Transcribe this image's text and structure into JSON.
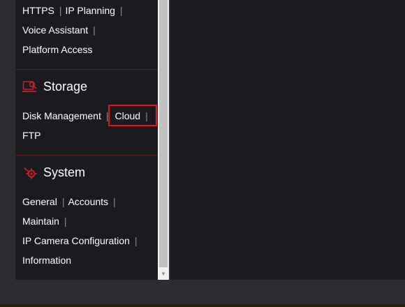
{
  "network": {
    "links": [
      "HTTPS",
      "IP Planning",
      "Voice Assistant",
      "Platform Access"
    ],
    "separator": "|"
  },
  "storage": {
    "title": "Storage",
    "icon": "storage-icon",
    "links": [
      "Disk Management",
      "Cloud",
      "FTP"
    ],
    "separator": "|"
  },
  "system": {
    "title": "System",
    "icon": "system-gear-icon",
    "links": [
      "General",
      "Accounts",
      "Maintain",
      "IP Camera Configuration",
      "Information"
    ],
    "separator": "|"
  },
  "colors": {
    "accent": "#c8202a",
    "highlight": "#e8141c",
    "sidebar_bg": "#1a1b1f",
    "main_bg": "#1c1d21"
  }
}
